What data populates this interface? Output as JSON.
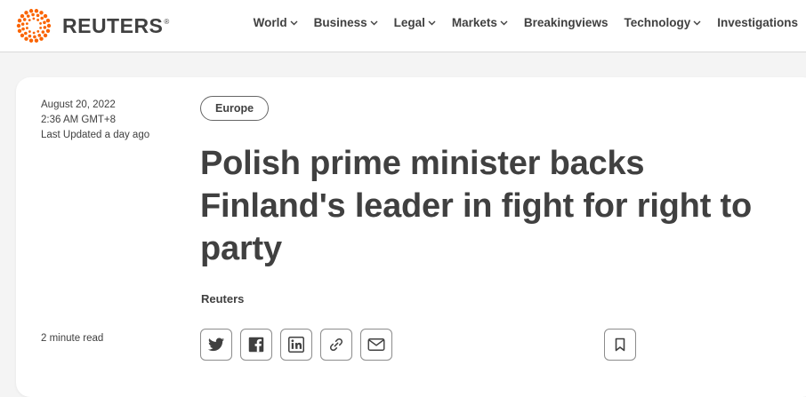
{
  "header": {
    "logo_text": "REUTERS",
    "logo_mark": "®",
    "nav": [
      {
        "label": "World",
        "dropdown": true
      },
      {
        "label": "Business",
        "dropdown": true
      },
      {
        "label": "Legal",
        "dropdown": true
      },
      {
        "label": "Markets",
        "dropdown": true
      },
      {
        "label": "Breakingviews",
        "dropdown": false
      },
      {
        "label": "Technology",
        "dropdown": true
      },
      {
        "label": "Investigations",
        "dropdown": false
      }
    ]
  },
  "article": {
    "date": "August 20, 2022",
    "time": "2:36 AM GMT+8",
    "updated": "Last Updated a day ago",
    "read_time": "2 minute read",
    "section_tag": "Europe",
    "headline": "Polish prime minister backs Finland's leader in fight for right to party",
    "byline": "Reuters"
  },
  "share_buttons": [
    {
      "icon": "twitter-icon"
    },
    {
      "icon": "facebook-icon"
    },
    {
      "icon": "linkedin-icon"
    },
    {
      "icon": "link-icon"
    },
    {
      "icon": "email-icon"
    }
  ],
  "bookmark_icon": "bookmark-icon",
  "colors": {
    "brand_orange": "#fa6400",
    "text": "#404040",
    "background": "#f4f4f4"
  }
}
